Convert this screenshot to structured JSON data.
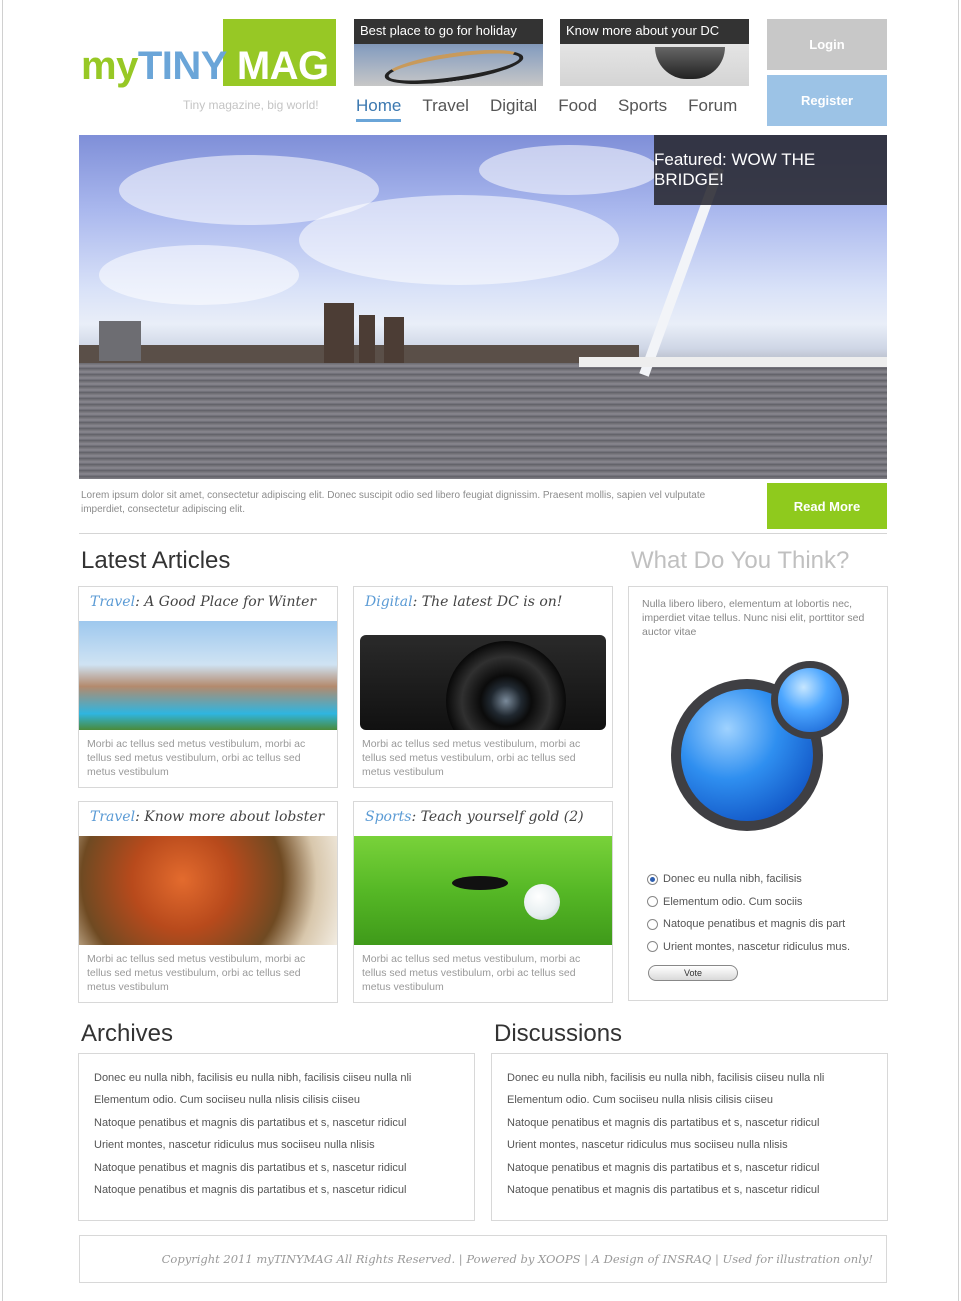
{
  "logo": {
    "part1": "my",
    "part2": "TINY",
    "part3": "MAG",
    "tagline": "Tiny magazine, big world!"
  },
  "promos": [
    {
      "label": "Best place to go for holiday"
    },
    {
      "label": "Know more about your DC"
    }
  ],
  "nav": [
    {
      "label": "Home"
    },
    {
      "label": "Travel"
    },
    {
      "label": "Digital"
    },
    {
      "label": "Food"
    },
    {
      "label": "Sports"
    },
    {
      "label": "Forum"
    }
  ],
  "auth": {
    "login": "Login",
    "register": "Register"
  },
  "hero": {
    "featured": "Featured: WOW THE BRIDGE!",
    "text": "Lorem ipsum dolor sit amet, consectetur adipiscing elit. Donec suscipit odio sed libero feugiat dignissim. Praesent mollis, sapien vel vulputate imperdiet, consectetur adipiscing elit.",
    "read_more": "Read More"
  },
  "latest": {
    "title": "Latest Articles",
    "articles": [
      {
        "category": "Travel",
        "title": ": A Good Place for Winter",
        "desc": "Morbi ac tellus sed metus vestibulum, morbi ac tellus sed metus vestibulum, orbi ac tellus sed metus vestibulum"
      },
      {
        "category": "Digital",
        "title": ": The latest DC is on!",
        "desc": "Morbi ac tellus sed metus vestibulum, morbi ac tellus sed metus vestibulum, orbi ac tellus sed metus vestibulum"
      },
      {
        "category": "Travel",
        "title": ": Know more about lobster",
        "desc": "Morbi ac tellus sed metus vestibulum, morbi ac tellus sed metus vestibulum, orbi ac tellus sed metus vestibulum"
      },
      {
        "category": "Sports",
        "title": ": Teach yourself gold (2)",
        "desc": "Morbi ac tellus sed metus vestibulum, morbi ac tellus sed metus vestibulum, orbi ac tellus sed metus vestibulum"
      }
    ]
  },
  "poll": {
    "title": "What Do You Think?",
    "question": "Nulla libero libero, elementum at lobortis nec, imperdiet vitae tellus. Nunc nisi elit, porttitor sed auctor vitae",
    "options": [
      "Donec eu nulla nibh, facilisis",
      "Elementum odio. Cum sociis",
      "Natoque penatibus et magnis dis part",
      "Urient montes, nascetur ridiculus mus."
    ],
    "vote": "Vote"
  },
  "archives": {
    "title": "Archives",
    "items": [
      "Donec eu nulla nibh, facilisis eu nulla nibh, facilisis ciiseu nulla nli",
      "Elementum odio. Cum sociiseu nulla nlisis cilisis ciiseu",
      "Natoque penatibus et magnis dis partatibus et s, nascetur ridicul",
      "Urient montes, nascetur ridiculus mus sociiseu nulla nlisis",
      "Natoque penatibus et magnis dis partatibus et s, nascetur ridicul",
      "Natoque penatibus et magnis dis partatibus et s, nascetur ridicul"
    ]
  },
  "discussions": {
    "title": "Discussions",
    "items": [
      "Donec eu nulla nibh, facilisis eu nulla nibh, facilisis ciiseu nulla nli",
      "Elementum odio. Cum sociiseu nulla nlisis cilisis ciiseu",
      "Natoque penatibus et magnis dis partatibus et s, nascetur ridicul",
      "Urient montes, nascetur ridiculus mus sociiseu nulla nlisis",
      "Natoque penatibus et magnis dis partatibus et s, nascetur ridicul",
      "Natoque penatibus et magnis dis partatibus et s, nascetur ridicul"
    ]
  },
  "footer": {
    "text": "Copyright 2011 myTINYMAG All Rights Reserved. | Powered by XOOPS | A Design of INSRAQ | Used for illustration only!"
  },
  "colors": {
    "green": "#97c825",
    "blue": "#6aa5d8",
    "link_blue": "#5b9bd5",
    "dark": "#333333"
  }
}
